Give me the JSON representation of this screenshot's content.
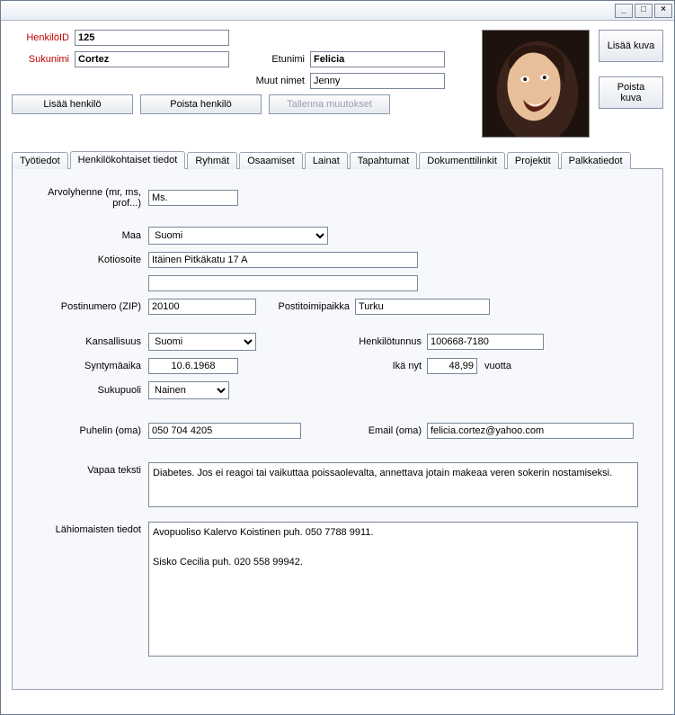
{
  "window": {
    "controls": {
      "min": "_",
      "max": "□",
      "close": "×"
    }
  },
  "header": {
    "labels": {
      "person_id": "HenkilöID",
      "surname": "Sukunimi",
      "firstname": "Etunimi",
      "othernames": "Muut nimet"
    },
    "values": {
      "person_id": "125",
      "surname": "Cortez",
      "firstname": "Felicia",
      "othernames": "Jenny"
    },
    "buttons": {
      "add_person": "Lisää henkilö",
      "delete_person": "Poista henkilö",
      "save_changes": "Tallenna muutokset",
      "add_photo": "Lisää kuva",
      "remove_photo": "Poista kuva"
    }
  },
  "tabs": [
    "Työtiedot",
    "Henkilökohtaiset tiedot",
    "Ryhmät",
    "Osaamiset",
    "Lainat",
    "Tapahtumat",
    "Dokumenttilinkit",
    "Projektit",
    "Palkkatiedot"
  ],
  "active_tab_index": 1,
  "personal": {
    "labels": {
      "title": "Arvolyhenne (mr, ms, prof...)",
      "country": "Maa",
      "home_address": "Kotiosoite",
      "zip": "Postinumero (ZIP)",
      "post_city": "Postitoimipaikka",
      "nationality": "Kansallisuus",
      "ssn": "Henkilötunnus",
      "birthdate": "Syntymäaika",
      "age_now": "Ikä nyt",
      "age_unit": "vuotta",
      "gender": "Sukupuoli",
      "phone": "Puhelin (oma)",
      "email": "Email (oma)",
      "free_text": "Vapaa teksti",
      "kin_info": "Lähiomaisten tiedot"
    },
    "values": {
      "title": "Ms.",
      "country": "Suomi",
      "home_address": "Itäinen Pitkäkatu 17 A",
      "home_address2": "",
      "zip": "20100",
      "post_city": "Turku",
      "nationality": "Suomi",
      "ssn": "100668-7180",
      "birthdate": "10.6.1968",
      "age_now": "48,99",
      "gender": "Nainen",
      "phone": "050 704 4205",
      "email": "felicia.cortez@yahoo.com",
      "free_text": "Diabetes. Jos ei reagoi tai vaikuttaa poissaolevalta, annettava jotain makeaa veren sokerin nostamiseksi.",
      "kin_info": "Avopuoliso Kalervo Koistinen puh. 050 7788 9911.\n\nSisko Cecilia puh. 020 558 99942."
    },
    "options": {
      "country": [
        "Suomi"
      ],
      "nationality": [
        "Suomi"
      ],
      "gender": [
        "Nainen"
      ]
    }
  }
}
